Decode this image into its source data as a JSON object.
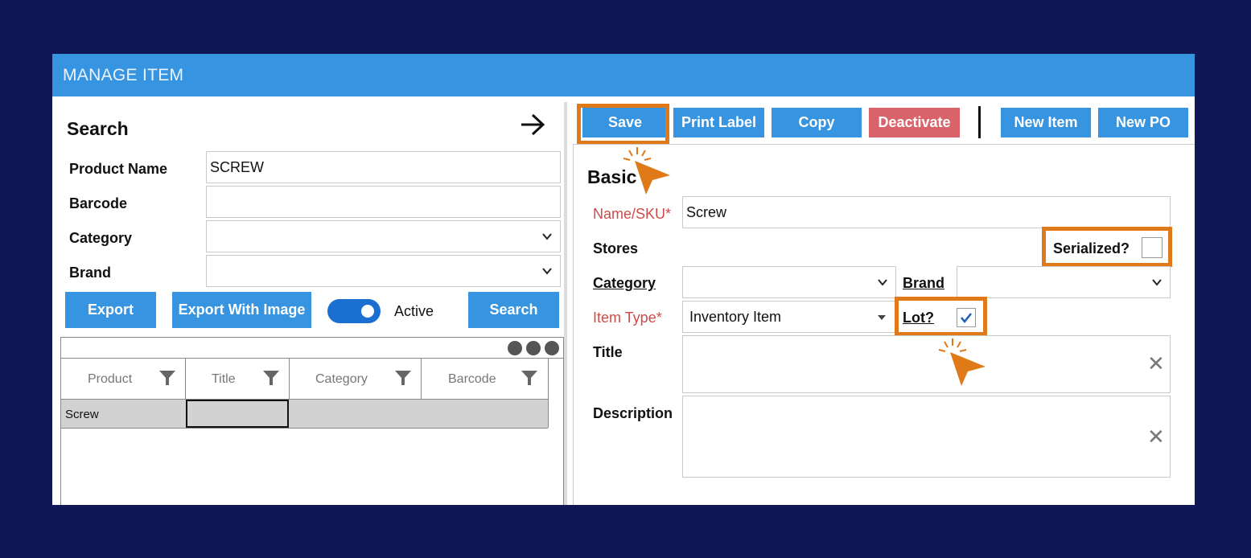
{
  "window": {
    "title": "MANAGE ITEM"
  },
  "search_panel": {
    "title": "Search",
    "fields": [
      {
        "label": "Product Name",
        "value": "SCREW"
      },
      {
        "label": "Barcode",
        "value": ""
      },
      {
        "label": "Category",
        "value": ""
      },
      {
        "label": "Brand",
        "value": ""
      }
    ],
    "export_label": "Export",
    "export_image_label": "Export With Image",
    "active_label": "Active",
    "active_on": true,
    "search_label": "Search"
  },
  "results_grid": {
    "columns": [
      "Product",
      "Title",
      "Category",
      "Barcode"
    ],
    "rows": [
      {
        "product": "Screw",
        "title": "",
        "category": "",
        "barcode": ""
      }
    ]
  },
  "toolbar": {
    "save": "Save",
    "print_label": "Print Label",
    "copy": "Copy",
    "deactivate": "Deactivate",
    "new_item": "New Item",
    "new_po": "New PO"
  },
  "basic": {
    "title": "Basic",
    "name_label": "Name/SKU*",
    "name_value": "Screw",
    "stores_label": "Stores",
    "serialized_label": "Serialized?",
    "serialized": false,
    "category_label": "Category",
    "category_value": "",
    "brand_label": "Brand",
    "brand_value": "",
    "item_type_label": "Item Type*",
    "item_type_value": "Inventory Item",
    "lot_label": "Lot?",
    "lot": true,
    "title_label": "Title",
    "title_value": "",
    "description_label": "Description",
    "description_value": ""
  },
  "colors": {
    "accent": "#3794e0",
    "danger": "#d9636b",
    "highlight": "#e07a18",
    "background": "#111656"
  }
}
